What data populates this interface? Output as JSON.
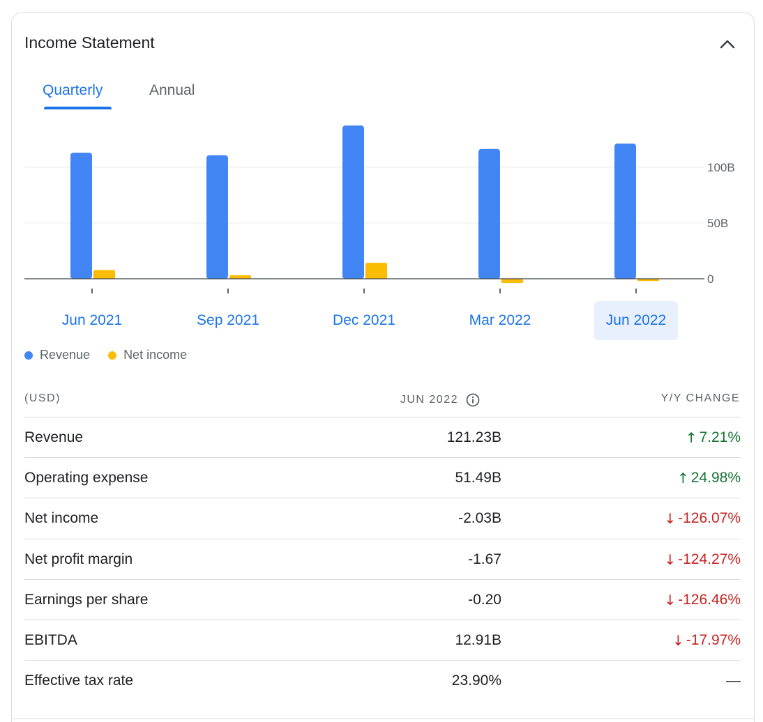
{
  "card": {
    "title": "Income Statement"
  },
  "tabs": [
    {
      "label": "Quarterly",
      "active": true
    },
    {
      "label": "Annual",
      "active": false
    }
  ],
  "chart_data": {
    "type": "bar",
    "categories": [
      "Jun 2021",
      "Sep 2021",
      "Dec 2021",
      "Mar 2022",
      "Jun 2022"
    ],
    "selected_category": "Jun 2022",
    "series": [
      {
        "name": "Revenue",
        "color": "#4285f4",
        "values": [
          113.08,
          110.81,
          137.41,
          116.44,
          121.23
        ]
      },
      {
        "name": "Net income",
        "color": "#fbbc04",
        "values": [
          7.78,
          3.16,
          14.32,
          -3.84,
          -2.03
        ]
      }
    ],
    "y_ticks": [
      {
        "value": 100,
        "label": "100B"
      },
      {
        "value": 50,
        "label": "50B"
      },
      {
        "value": 0,
        "label": "0"
      }
    ],
    "ylim": [
      -5,
      140
    ],
    "grid": true,
    "legend_position": "bottom-left"
  },
  "table": {
    "headers": {
      "label": "(USD)",
      "date": "JUN 2022",
      "change": "Y/Y CHANGE"
    },
    "rows": [
      {
        "label": "Revenue",
        "value": "121.23B",
        "change": "7.21%",
        "dir": "up"
      },
      {
        "label": "Operating expense",
        "value": "51.49B",
        "change": "24.98%",
        "dir": "up"
      },
      {
        "label": "Net income",
        "value": "-2.03B",
        "change": "-126.07%",
        "dir": "down"
      },
      {
        "label": "Net profit margin",
        "value": "-1.67",
        "change": "-124.27%",
        "dir": "down"
      },
      {
        "label": "Earnings per share",
        "value": "-0.20",
        "change": "-126.46%",
        "dir": "down"
      },
      {
        "label": "EBITDA",
        "value": "12.91B",
        "change": "-17.97%",
        "dir": "down"
      },
      {
        "label": "Effective tax rate",
        "value": "23.90%",
        "change": "—",
        "dir": "none"
      }
    ]
  },
  "icons": {
    "collapse": "chevron-up-icon",
    "info": "info-icon",
    "up": "arrow-up-icon",
    "down": "arrow-down-icon"
  }
}
